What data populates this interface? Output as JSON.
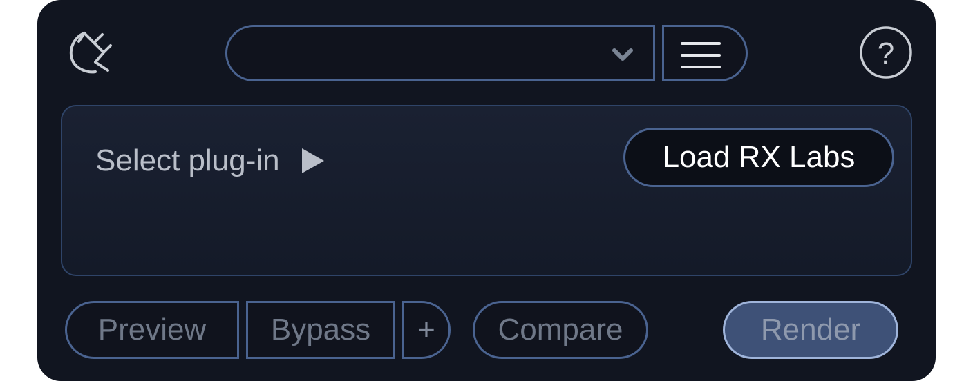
{
  "icons": {
    "plugin": "plug-icon",
    "dropdown": "chevron-down-icon",
    "menu": "hamburger-icon",
    "help": "question-icon",
    "select": "play-icon"
  },
  "header": {
    "preset_value": "",
    "help_glyph": "?"
  },
  "plugin_slot": {
    "select_label": "Select plug-in",
    "load_button": "Load RX Labs"
  },
  "footer": {
    "preview_label": "Preview",
    "bypass_label": "Bypass",
    "plus_label": "+",
    "compare_label": "Compare",
    "render_label": "Render"
  },
  "colors": {
    "panel_bg": "#111520",
    "border": "#4a6390",
    "render_bg": "#3e5177",
    "render_border": "#9fb4da",
    "disabled_text": "#6f7888"
  }
}
